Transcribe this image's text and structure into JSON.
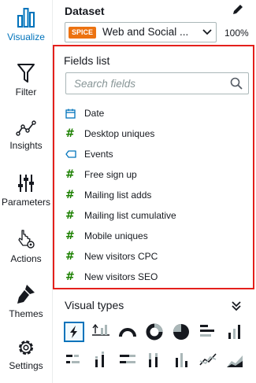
{
  "rail": {
    "items": [
      {
        "label": "Visualize",
        "icon": "bar-chart-icon",
        "active": true
      },
      {
        "label": "Filter",
        "icon": "funnel-icon"
      },
      {
        "label": "Insights",
        "icon": "line-chart-icon"
      },
      {
        "label": "Parameters",
        "icon": "sliders-icon"
      },
      {
        "label": "Actions",
        "icon": "pointer-gear-icon"
      },
      {
        "label": "Themes",
        "icon": "brush-icon"
      },
      {
        "label": "Settings",
        "icon": "gear-icon"
      }
    ]
  },
  "dataset": {
    "title": "Dataset",
    "badge": "SPICE",
    "name": "Web and Social ...",
    "percent": "100%"
  },
  "fields": {
    "title": "Fields list",
    "search_placeholder": "Search fields",
    "items": [
      {
        "label": "Date",
        "type": "date"
      },
      {
        "label": "Desktop uniques",
        "type": "measure"
      },
      {
        "label": "Events",
        "type": "dimension"
      },
      {
        "label": "Free sign up",
        "type": "measure"
      },
      {
        "label": "Mailing list adds",
        "type": "measure"
      },
      {
        "label": "Mailing list cumulative",
        "type": "measure"
      },
      {
        "label": "Mobile uniques",
        "type": "measure"
      },
      {
        "label": "New visitors CPC",
        "type": "measure"
      },
      {
        "label": "New visitors SEO",
        "type": "measure"
      }
    ]
  },
  "visual_types": {
    "title": "Visual types"
  },
  "colors": {
    "accent": "#0073bb",
    "highlight": "#e4201c",
    "spice": "#ec7211",
    "measure": "#1d8102"
  }
}
